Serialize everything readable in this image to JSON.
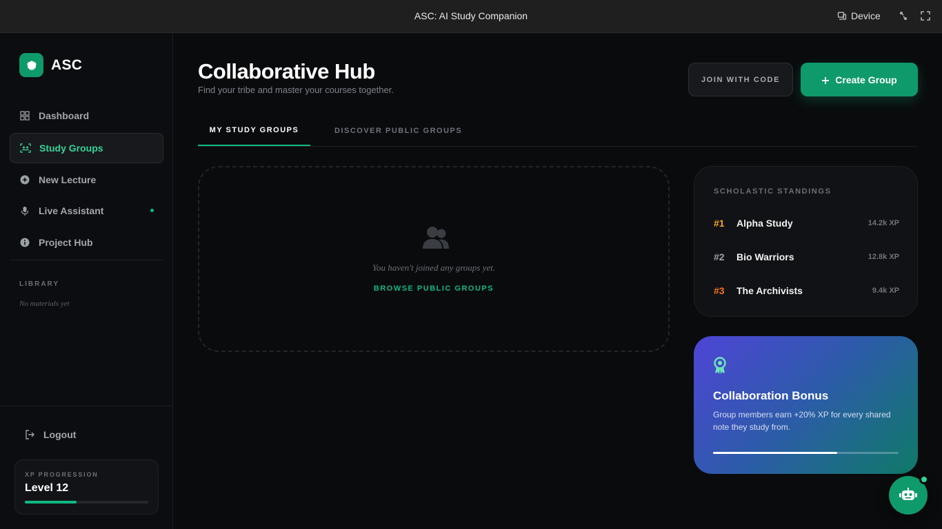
{
  "window": {
    "title": "ASC: AI Study Companion",
    "device_label": "Device"
  },
  "sidebar": {
    "brand": "ASC",
    "items": [
      {
        "label": "Dashboard",
        "icon": "grid-icon"
      },
      {
        "label": "Study Groups",
        "icon": "people-scan-icon",
        "active": true
      },
      {
        "label": "New Lecture",
        "icon": "plus-circle-icon"
      },
      {
        "label": "Live Assistant",
        "icon": "microphone-icon",
        "status": "live"
      },
      {
        "label": "Project Hub",
        "icon": "info-circle-icon"
      }
    ],
    "library": {
      "heading": "LIBRARY",
      "empty": "No materials yet"
    },
    "logout": "Logout",
    "xp": {
      "label": "XP PROGRESSION",
      "level": "Level 12",
      "progress": 0.42
    }
  },
  "main": {
    "title": "Collaborative Hub",
    "subtitle": "Find your tribe and master your courses together.",
    "join_button": "JOIN WITH CODE",
    "create_button": "Create Group",
    "tabs": [
      {
        "label": "MY STUDY GROUPS",
        "active": true
      },
      {
        "label": "DISCOVER PUBLIC GROUPS",
        "active": false
      }
    ],
    "empty_state": {
      "message": "You haven't joined any groups yet.",
      "link": "BROWSE PUBLIC GROUPS"
    }
  },
  "standings": {
    "heading": "SCHOLASTIC STANDINGS",
    "rows": [
      {
        "rank": "#1",
        "name": "Alpha Study",
        "xp": "14.2k XP",
        "color": "#f5a524"
      },
      {
        "rank": "#2",
        "name": "Bio Warriors",
        "xp": "12.8k XP",
        "color": "#9ca3af"
      },
      {
        "rank": "#3",
        "name": "The Archivists",
        "xp": "9.4k XP",
        "color": "#f97316"
      }
    ]
  },
  "bonus": {
    "title": "Collaboration Bonus",
    "description": "Group members earn +20% XP for every shared note they study from.",
    "progress": 0.67
  },
  "colors": {
    "accent": "#10b981",
    "accent_dark": "#0f9a6c",
    "background": "#0a0b0d"
  }
}
